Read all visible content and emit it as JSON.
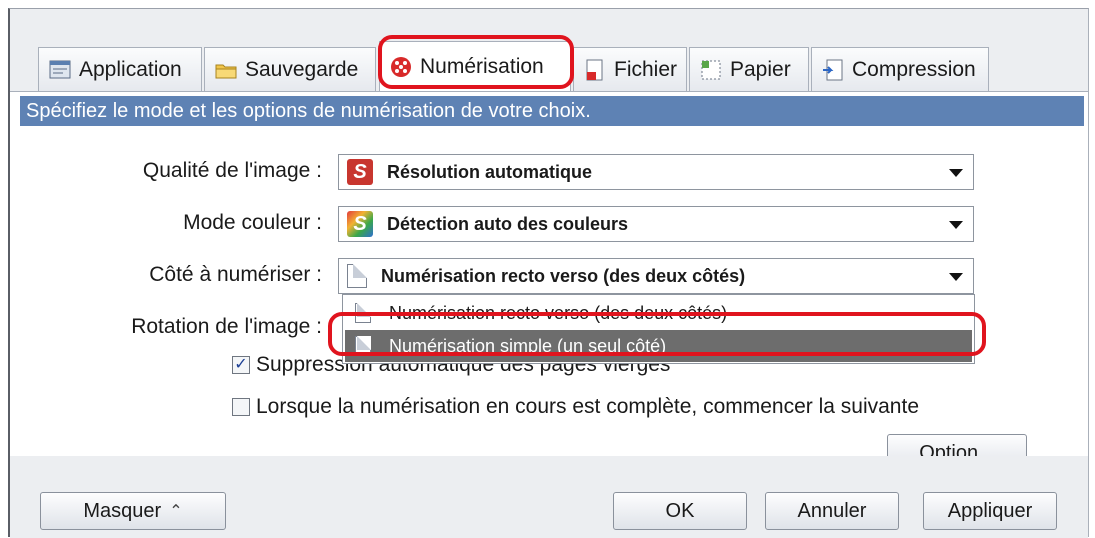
{
  "tabs": [
    {
      "label": "Application",
      "icon": "application-icon"
    },
    {
      "label": "Sauvegarde",
      "icon": "folder-icon"
    },
    {
      "label": "Numérisation",
      "icon": "scan-icon"
    },
    {
      "label": "Fichier",
      "icon": "file-icon"
    },
    {
      "label": "Papier",
      "icon": "paper-icon"
    },
    {
      "label": "Compression",
      "icon": "compression-icon"
    }
  ],
  "active_tab": "Numérisation",
  "banner": "Spécifiez le mode et les options de numérisation de votre choix.",
  "fields": {
    "quality": {
      "label": "Qualité de l'image :",
      "value": "Résolution automatique",
      "icon_color": "#c8362f"
    },
    "color_mode": {
      "label": "Mode couleur :",
      "value": "Détection auto des couleurs"
    },
    "side": {
      "label": "Côté à numériser :",
      "value": "Numérisation recto verso (des deux côtés)"
    },
    "rotation": {
      "label": "Rotation de l'image :"
    }
  },
  "dropdown": {
    "options": [
      "Numérisation recto verso (des deux côtés)",
      "Numérisation simple (un seul côté)"
    ],
    "highlighted_option": "Numérisation simple (un seul côté)"
  },
  "checkboxes": [
    {
      "label": "Suppression automatique des pages vierges",
      "checked": true
    },
    {
      "label": "Lorsque la numérisation en cours est complète, commencer la suivante",
      "checked": false
    }
  ],
  "option_button": "Option...",
  "footer": {
    "hide": "Masquer",
    "ok": "OK",
    "cancel": "Annuler",
    "apply": "Appliquer"
  },
  "colors": {
    "banner": "#5e82b4",
    "highlight": "#e0141e",
    "selected_option": "#6d6d6d"
  }
}
